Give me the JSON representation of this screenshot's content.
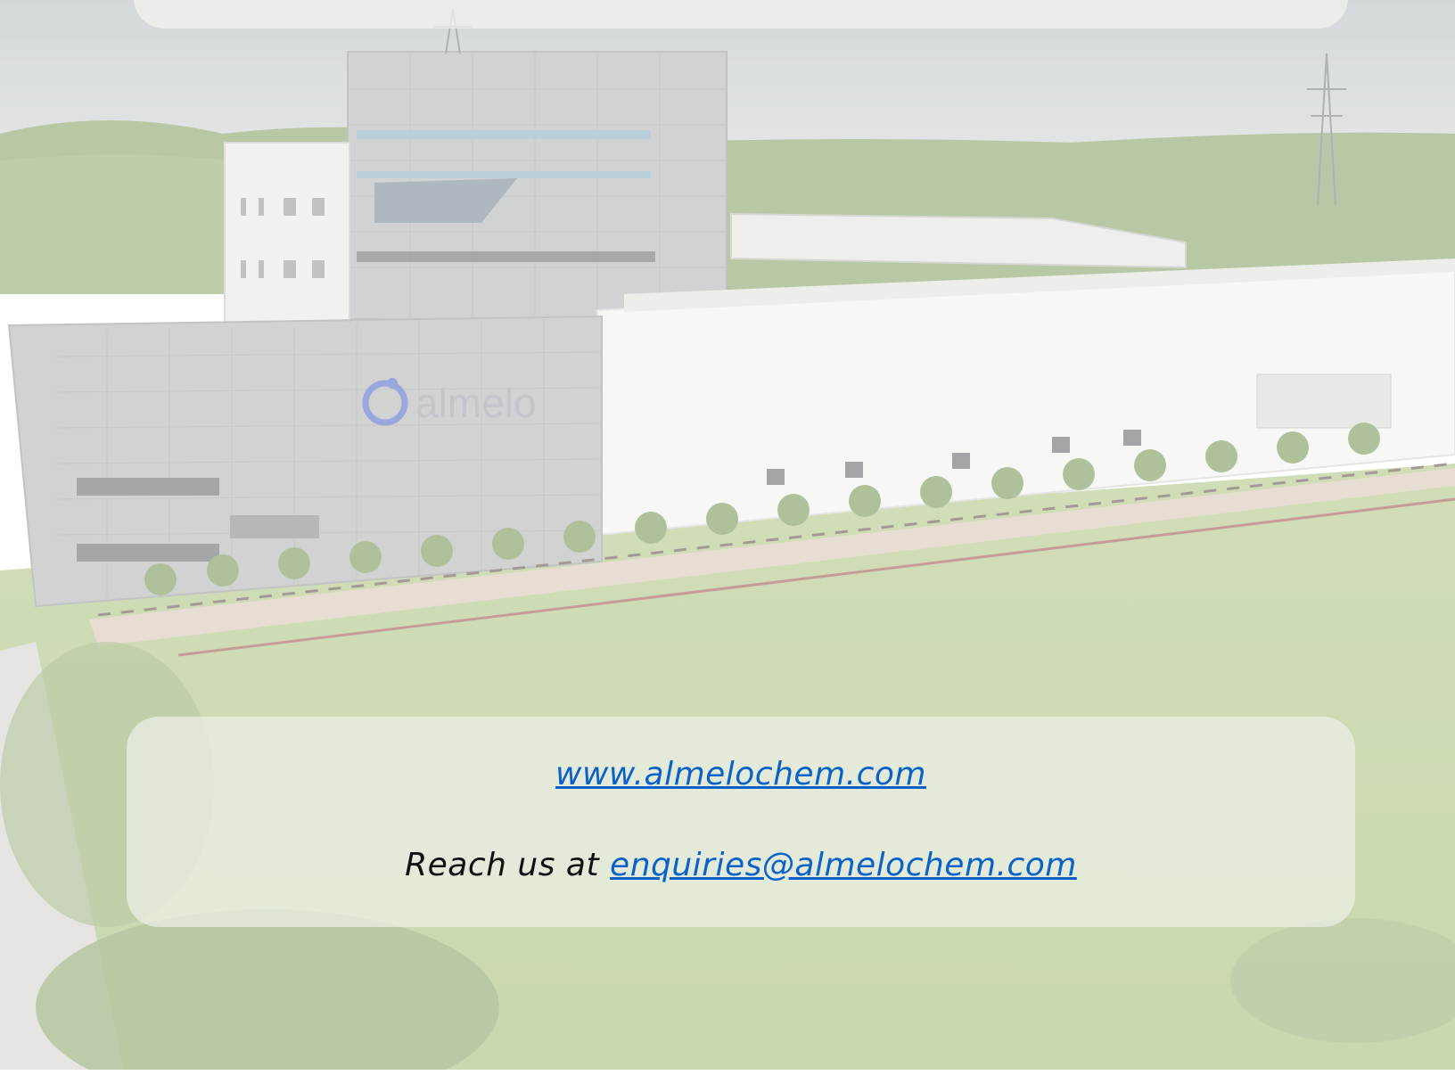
{
  "photo": {
    "subject": "factory-campus-aerial",
    "building_sign": "almelo",
    "colors": {
      "sky": "#c7cdd0",
      "grass": "#b7cc8a",
      "trees": "#8fa86a",
      "facade": "#f2f2ef",
      "tower": "#b3b6b8",
      "logo_blue": "#5a72c8"
    }
  },
  "contact": {
    "website": "www.almelochem.com",
    "reach_prefix": "Reach us at ",
    "email": "enquiries@almelochem.com",
    "link_color": "#0a62c9"
  }
}
